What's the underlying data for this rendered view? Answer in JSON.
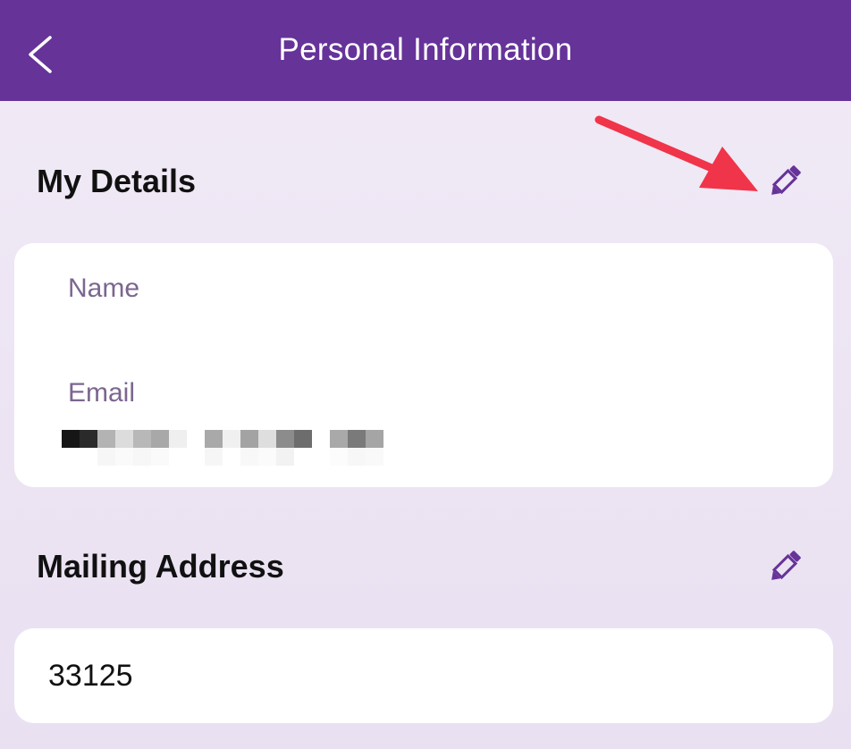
{
  "header": {
    "title": "Personal Information",
    "background_color": "#663399"
  },
  "my_details": {
    "title": "My Details",
    "fields": {
      "name_label": "Name",
      "email_label": "Email"
    }
  },
  "mailing_address": {
    "title": "Mailing Address",
    "value": "33125"
  },
  "icons": {
    "back": "chevron-left-icon",
    "edit": "pencil-icon"
  },
  "colors": {
    "accent": "#663399",
    "label": "#7c6690",
    "annotation_arrow": "#f0344a"
  }
}
